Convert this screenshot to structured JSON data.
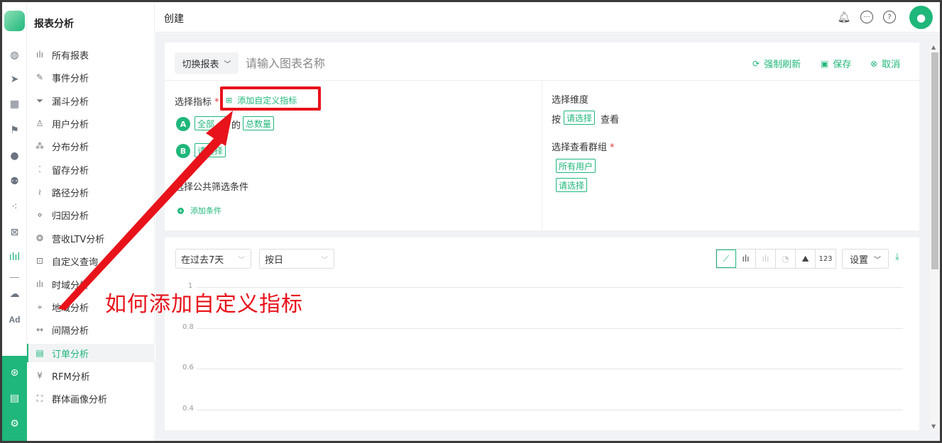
{
  "sidebar": {
    "title": "报表分析",
    "items": [
      {
        "label": "所有报表",
        "icon": "bar-chart-icon",
        "glyph": "ılı"
      },
      {
        "label": "事件分析",
        "icon": "edit-icon",
        "glyph": "✎"
      },
      {
        "label": "漏斗分析",
        "icon": "funnel-icon",
        "glyph": "⏷"
      },
      {
        "label": "用户分析",
        "icon": "user-icon",
        "glyph": "♙"
      },
      {
        "label": "分布分析",
        "icon": "distribution-icon",
        "glyph": "⁂"
      },
      {
        "label": "留存分析",
        "icon": "retention-icon",
        "glyph": "⁚"
      },
      {
        "label": "路径分析",
        "icon": "path-icon",
        "glyph": "≀"
      },
      {
        "label": "归因分析",
        "icon": "attribution-icon",
        "glyph": "⋄"
      },
      {
        "label": "营收LTV分析",
        "icon": "revenue-icon",
        "glyph": "❂"
      },
      {
        "label": "自定义查询",
        "icon": "query-icon",
        "glyph": "⊡"
      },
      {
        "label": "时域分析",
        "icon": "time-domain-icon",
        "glyph": "ılı"
      },
      {
        "label": "地域分析",
        "icon": "location-icon",
        "glyph": "⌖"
      },
      {
        "label": "间隔分析",
        "icon": "interval-icon",
        "glyph": "↔"
      },
      {
        "label": "订单分析",
        "icon": "order-icon",
        "glyph": "▤"
      },
      {
        "label": "RFM分析",
        "icon": "rfm-icon",
        "glyph": "¥"
      },
      {
        "label": "群体画像分析",
        "icon": "portrait-icon",
        "glyph": "⛶"
      }
    ]
  },
  "header": {
    "title": "创建"
  },
  "editor": {
    "switch_label": "切换报表",
    "name_placeholder": "请输入图表名称",
    "refresh_label": "强制刷新",
    "save_label": "保存",
    "cancel_label": "取消",
    "metric_label": "选择指标",
    "required_mark": "*",
    "add_custom_metric": "添加自定义指标",
    "metric_a_badge": "A",
    "metric_a_event": "全部",
    "metric_a_of": "的",
    "metric_a_agg": "总数量",
    "metric_b_badge": "B",
    "metric_b_select": "请选择",
    "filter_label": "选择公共筛选条件",
    "add_condition": "添加条件",
    "dimension_label": "选择维度",
    "by_label": "按",
    "dimension_select": "请选择",
    "view_label": "查看",
    "group_label": "选择查看群组",
    "group_all": "所有用户",
    "group_select": "请选择"
  },
  "chart_panel": {
    "date_range": "在过去7天",
    "granularity": "按日",
    "settings_label": "设置",
    "number_view_label": "123"
  },
  "chart_data": {
    "type": "line",
    "series": [],
    "x": [],
    "yticks": [
      "1",
      "0.8",
      "0.6",
      "0.4"
    ],
    "ylim": [
      0.4,
      1
    ]
  },
  "annotation": {
    "text": "如何添加自定义指标"
  },
  "colors": {
    "accent": "#1fb77a",
    "annotation": "#e8121a"
  }
}
